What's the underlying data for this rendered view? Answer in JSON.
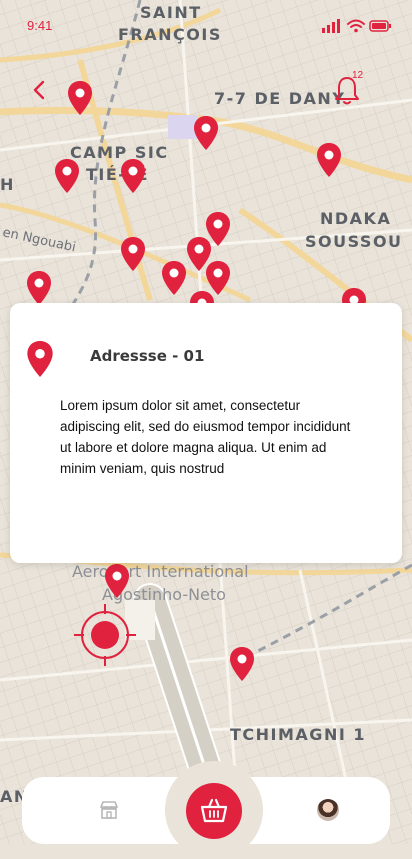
{
  "status_bar": {
    "time": "9:41"
  },
  "map": {
    "labels": {
      "saint_francois_1": "SAINT",
      "saint_francois_2": "FRANÇOIS",
      "sept_sept": "7-7 DE DANY",
      "camp_sic_1": "CAMP SIC",
      "camp_sic_2": "TIÉ-TÉ",
      "ndaka_1": "NDAKA",
      "ndaka_2": "SOUSSOU",
      "road": "en Ngouabi",
      "airport_1": "Aeroport International",
      "airport_2": "Agostinho-Neto",
      "tchimagni": "TCHIMAGNI 1",
      "left_h": "H",
      "left_an": "AN"
    }
  },
  "notifications": {
    "count": "12"
  },
  "card": {
    "title": "Adressse - 01",
    "description": "Lorem ipsum dolor sit amet, consectetur adipiscing elit, sed do eiusmod tempor incididunt ut labore et dolore magna aliqua. Ut enim ad minim veniam, quis nostrud"
  },
  "colors": {
    "accent": "#e0223f",
    "map_bg": "#e9e3d9",
    "road": "#f3d79a"
  },
  "icons": {
    "back": "chevron-left-icon",
    "bell": "bell-icon",
    "store": "store-icon",
    "cart": "basket-icon",
    "avatar": "avatar"
  }
}
